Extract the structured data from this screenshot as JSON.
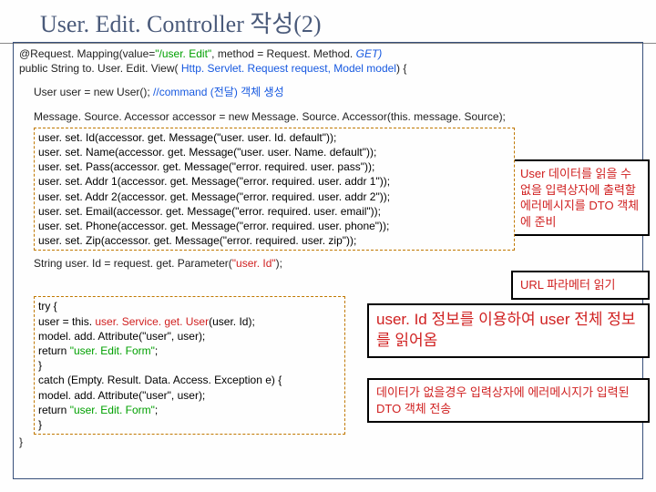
{
  "title": "User. Edit. Controller 작성(2)",
  "sig": {
    "mapping_pre": "@Request. Mapping(value=",
    "mapping_val": "\"/user. Edit\"",
    "mapping_mid": ", method = Request. Method. ",
    "mapping_get": "GET)",
    "decl_pre": "public String to. User. Edit. View( ",
    "decl_params": "Http. Servlet. Request request, Model model",
    "decl_post": ") {"
  },
  "cmd": {
    "line_pre": "User user = new User();  ",
    "comment": "//command (전달) 객체 생성"
  },
  "accessor_line": "Message. Source. Accessor accessor = new Message. Source. Accessor(this. message. Source);",
  "setters": [
    "user. set. Id(accessor. get. Message(\"user. user. Id. default\"));",
    "user. set. Name(accessor. get. Message(\"user. user. Name. default\"));",
    "user. set. Pass(accessor. get. Message(\"error. required. user. pass\"));",
    "user. set. Addr 1(accessor. get. Message(\"error. required. user. addr 1\"));",
    "user. set. Addr 2(accessor. get. Message(\"error. required. user. addr 2\"));",
    "user. set. Email(accessor. get. Message(\"error. required. user. email\"));",
    "user. set. Phone(accessor. get. Message(\"error. required. user. phone\"));",
    "user. set. Zip(accessor. get. Message(\"error. required. user. zip\"));"
  ],
  "param_line": {
    "pre": "String user. Id = request. get. Parameter(",
    "arg": "\"user. Id\"",
    "post": ");"
  },
  "try_block": {
    "l0": "try {",
    "l1_pre": "  user = this. ",
    "l1_svc": "user. Service. get. User",
    "l1_post": "(user. Id);",
    "l2": "  model. add. Attribute(\"user\", user);",
    "l3_pre": "  return ",
    "l3_val": "\"user. Edit. Form\"",
    "l3_post": ";",
    "l4": "}",
    "l5": "catch (Empty. Result. Data. Access. Exception e) {",
    "l6": "  model. add. Attribute(\"user\", user);",
    "l7_pre": "  return ",
    "l7_val": "\"user. Edit. Form\"",
    "l7_post": ";",
    "l8": "}"
  },
  "close_brace": "}",
  "annot": {
    "a1": "User 데이터를 읽을 수 없을 입력상자에 출력할 에러메시지를 DTO 객체에 준비",
    "a2": "URL 파라메터 읽기",
    "a3": "user. Id 정보를 이용하여 user 전체 정보를 읽어옴",
    "a4": "데이터가 없을경우 입력상자에 에러메시지가 입력된 DTO 객체 전송"
  }
}
